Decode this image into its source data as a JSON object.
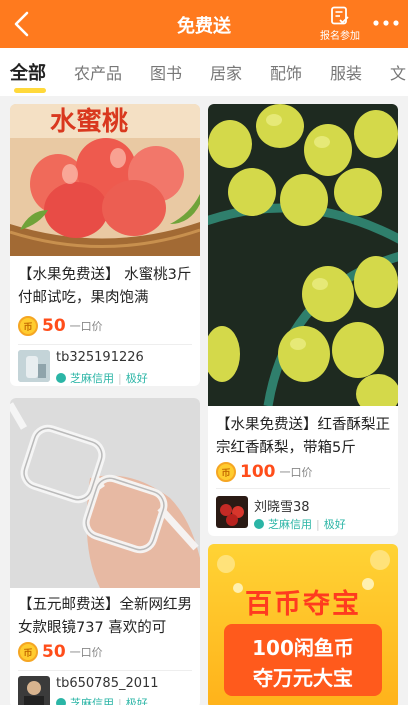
{
  "header": {
    "title": "免费送",
    "enroll_label": "报名参加",
    "accent": "#ff7a1e"
  },
  "tabs": [
    {
      "label": "全部",
      "active": true
    },
    {
      "label": "农产品"
    },
    {
      "label": "图书"
    },
    {
      "label": "居家"
    },
    {
      "label": "配饰"
    },
    {
      "label": "服装"
    },
    {
      "label": "文"
    }
  ],
  "feed": {
    "price_unit": "一口价",
    "credit_label": "芝麻信用",
    "credit_level": "极好",
    "items": [
      {
        "title": "【水果免费送】 水蜜桃3斤付邮试吃，果肉饱满",
        "price": "50",
        "seller": "tb325191226",
        "image": "peaches",
        "image_caption": "水蜜桃"
      },
      {
        "title": "【水果免费送】红香酥梨正宗红香酥梨，带箱5斤",
        "price": "100",
        "seller": "刘晓雪38",
        "image": "pears"
      },
      {
        "title": "【五元邮费送】全新网红男女款眼镜737 喜欢的可",
        "price": "50",
        "seller": "tb650785_2011",
        "image": "glasses"
      }
    ]
  },
  "ad": {
    "title": "百币夺宝",
    "line1": "100闲鱼币",
    "line2": "夺万元大宝"
  }
}
